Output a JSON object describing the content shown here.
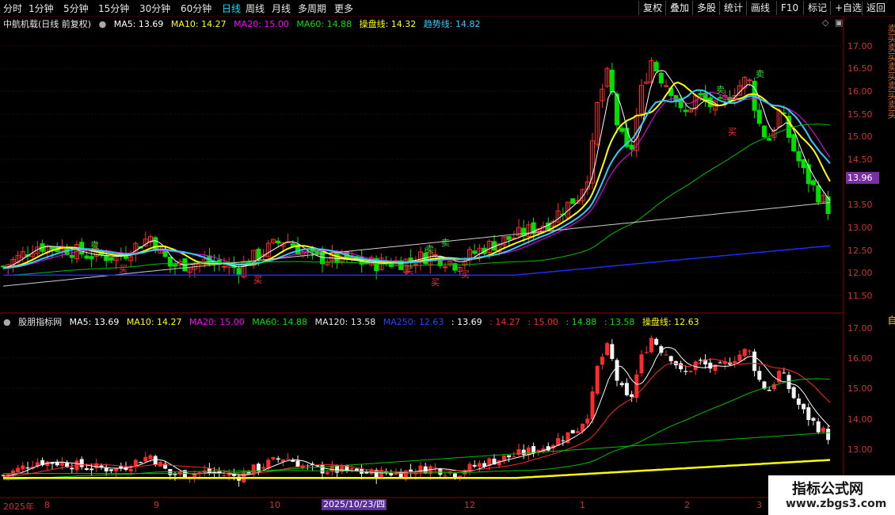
{
  "toolbar": {
    "tabs": [
      "分时",
      "1分钟",
      "5分钟",
      "15分钟",
      "30分钟",
      "60分钟",
      "日线",
      "周线",
      "月线",
      "多周期",
      "更多"
    ],
    "active_tab": "日线",
    "buttons": [
      "复权",
      "叠加",
      "多股",
      "统计",
      "画线",
      "F10",
      "标记",
      "+自选",
      "返回"
    ]
  },
  "main_panel": {
    "stock_name": "中航机载(日线 前复权)",
    "ma5": "MA5: 13.69",
    "ma10": "MA10: 14.27",
    "ma20": "MA20: 15.00",
    "ma60": "MA60: 14.88",
    "cpx": "操盘线: 14.32",
    "trend": "趋势线: 14.82",
    "price_tag": "13.96",
    "yaxis": [
      "17.00",
      "16.50",
      "16.00",
      "15.50",
      "15.00",
      "14.50",
      "14.00",
      "13.50",
      "13.00",
      "12.50",
      "12.00",
      "11.50"
    ],
    "buy_marker": "买",
    "sell_marker": "卖"
  },
  "sub_panel": {
    "name": "股朋指标网",
    "ma5": "MA5: 13.69",
    "ma10": "MA10: 14.27",
    "ma20": "MA20: 15.00",
    "ma60": "MA60: 14.88",
    "ma120": "MA120: 13.58",
    "ma250": "MA250: 12.63",
    "v1": ": 13.69",
    "v2": ": 14.27",
    "v3": ": 15.00",
    "v4": ": 14.88",
    "v5": ": 13.58",
    "cpx": "操盘线: 12.63",
    "yaxis": [
      "17.00",
      "16.00",
      "15.00",
      "14.00",
      "13.00"
    ]
  },
  "xaxis": {
    "labels": [
      "2025年",
      "8",
      "9",
      "10",
      "12",
      "1",
      "2",
      "3"
    ],
    "highlight": "2025/10/23/四"
  },
  "side_vertical_text": [
    "卖买卖买卖买卖买卖买",
    "自"
  ],
  "watermark": {
    "line1": "指标公式网",
    "line2": "www.zbgs3.com"
  },
  "colors": {
    "up": "#ff2a2a",
    "down": "#00e000",
    "ma5": "#ffffff",
    "ma10": "#ffff00",
    "ma20": "#ff00ff",
    "ma60": "#00c000",
    "cyan": "#33ccff",
    "ma250": "#1a2cff"
  }
}
